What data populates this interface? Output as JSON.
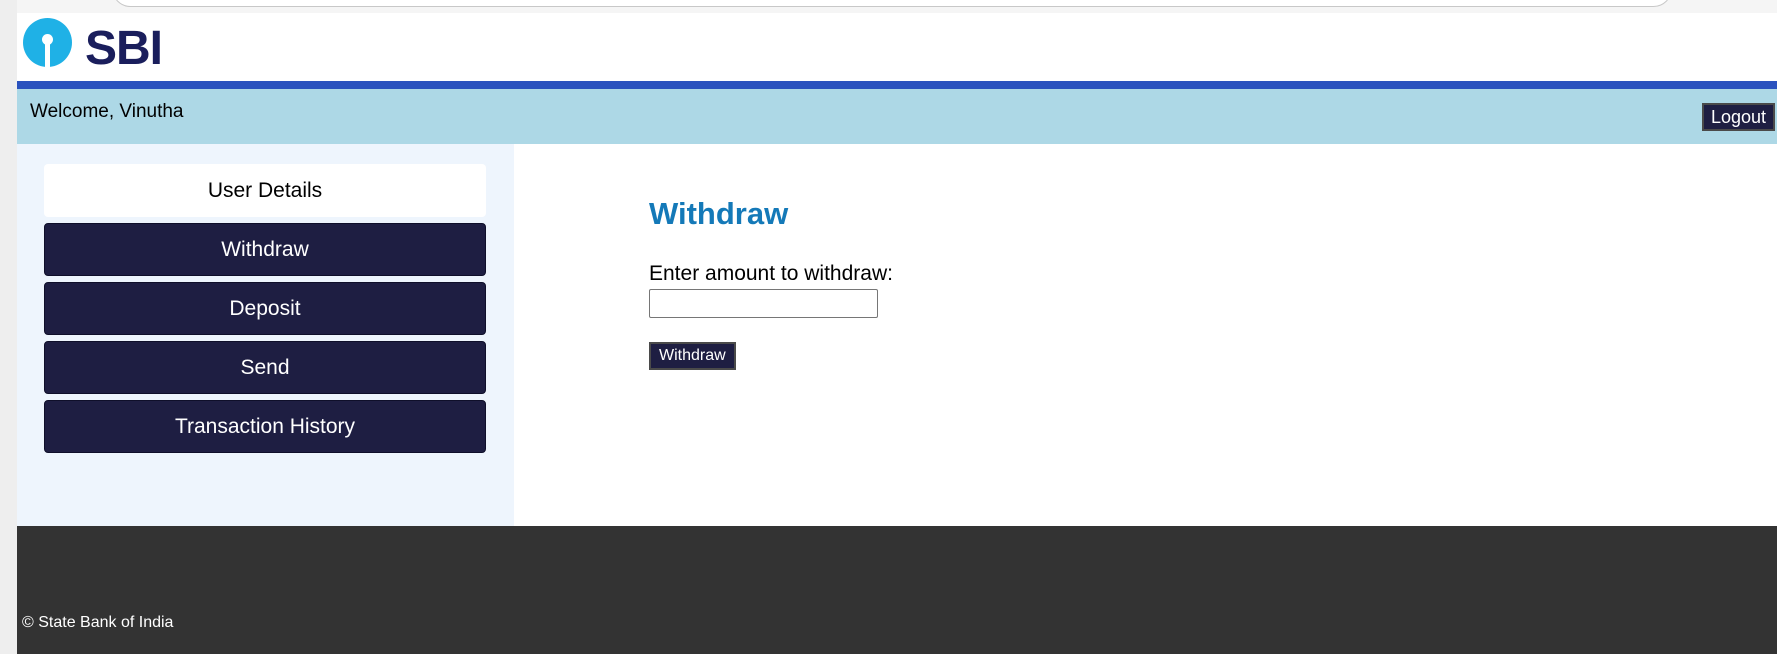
{
  "logo": {
    "text": "SBI",
    "icon": "sbi-keyhole-logo-icon",
    "color": "#1a1e5c",
    "icon_color": "#1fb1e6"
  },
  "header": {
    "welcome": "Welcome, Vinutha",
    "logout_label": "Logout",
    "bar_color": "#add8e6",
    "accent_color": "#2a52be"
  },
  "sidebar": {
    "items": [
      {
        "label": "User Details",
        "style": "light"
      },
      {
        "label": "Withdraw",
        "style": "dark"
      },
      {
        "label": "Deposit",
        "style": "dark"
      },
      {
        "label": "Send",
        "style": "dark"
      },
      {
        "label": "Transaction History",
        "style": "dark"
      }
    ],
    "button_color": "#1e1e42"
  },
  "main": {
    "title": "Withdraw",
    "amount_label": "Enter amount to withdraw:",
    "amount_value": "",
    "submit_label": "Withdraw",
    "title_color": "#1479b8"
  },
  "footer": {
    "copyright": "© State Bank of India",
    "color": "#333333"
  }
}
